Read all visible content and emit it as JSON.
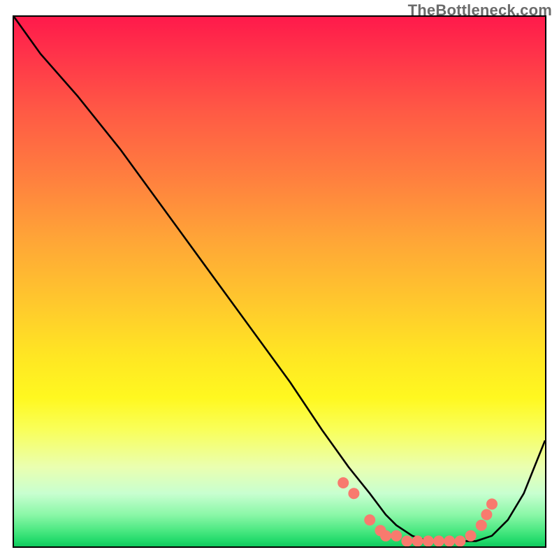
{
  "watermark": "TheBottleneck.com",
  "chart_data": {
    "type": "line",
    "title": "",
    "xlabel": "",
    "ylabel": "",
    "xlim": [
      0,
      100
    ],
    "ylim": [
      0,
      100
    ],
    "series": [
      {
        "name": "curve",
        "x": [
          0,
          5,
          12,
          20,
          28,
          36,
          44,
          52,
          58,
          63,
          67,
          70,
          72,
          75,
          78,
          81,
          84,
          87,
          90,
          93,
          96,
          100
        ],
        "values": [
          100,
          93,
          85,
          75,
          64,
          53,
          42,
          31,
          22,
          15,
          10,
          6,
          4,
          2,
          1,
          1,
          1,
          1,
          2,
          5,
          10,
          20
        ]
      }
    ],
    "markers": {
      "name": "highlight-points",
      "color": "#f87a6e",
      "x": [
        62,
        64,
        67,
        69,
        70,
        72,
        74,
        76,
        78,
        80,
        82,
        84,
        86,
        88,
        89,
        90
      ],
      "values": [
        12,
        10,
        5,
        3,
        2,
        2,
        1,
        1,
        1,
        1,
        1,
        1,
        2,
        4,
        6,
        8
      ]
    },
    "gradient": {
      "direction": "vertical",
      "stops_hint": [
        "red-top",
        "orange",
        "yellow",
        "pale-yellow",
        "green-bottom"
      ]
    }
  }
}
